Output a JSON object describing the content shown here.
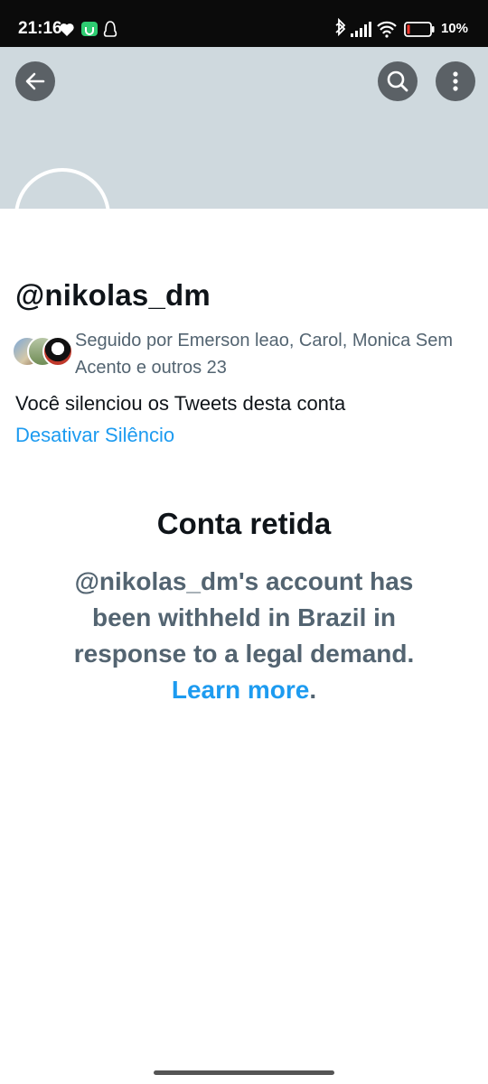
{
  "status_bar": {
    "time": "21:16",
    "battery_text": "10%",
    "left_icons": [
      "heart-icon",
      "app-notification-icon",
      "penguin-icon"
    ],
    "right_icons": [
      "bluetooth-icon",
      "signal-icon",
      "wifi-icon",
      "battery-icon"
    ],
    "battery_level": 0.1
  },
  "header": {
    "banner_color": "#cfd9de",
    "back_icon": "arrow-left-icon",
    "search_icon": "search-icon",
    "more_icon": "more-vertical-icon"
  },
  "profile": {
    "handle": "@nikolas_dm",
    "followed_by": "Seguido por Emerson leao, Carol, Monica Sem Acento e outros 23",
    "muted_notice": "Você silenciou os Tweets desta conta",
    "unmute_label": "Desativar Silêncio"
  },
  "withheld": {
    "title": "Conta retida",
    "message": "@nikolas_dm's account has been withheld in Brazil in response to a legal demand.",
    "learn_more": "Learn more",
    "trailing": "."
  },
  "colors": {
    "link": "#1d9bf0",
    "secondary_text": "#536471",
    "primary_text": "#0f1419"
  }
}
